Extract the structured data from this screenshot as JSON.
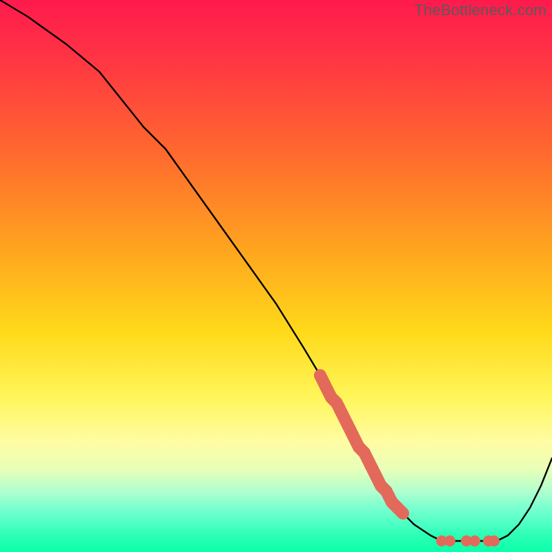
{
  "chart_data": {
    "type": "line",
    "title": "",
    "xlabel": "",
    "ylabel": "",
    "xlim": [
      0,
      100
    ],
    "ylim": [
      0,
      100
    ],
    "series": [
      {
        "name": "bottleneck-curve",
        "x": [
          0,
          5,
          12,
          18,
          22,
          26,
          30,
          35,
          40,
          45,
          50,
          55,
          58,
          61,
          63,
          64,
          67,
          70,
          72,
          73,
          75,
          78,
          80,
          82,
          83,
          85,
          88,
          90,
          92,
          94,
          96,
          98,
          100
        ],
        "values": [
          100,
          97,
          92,
          87,
          82,
          77,
          73,
          66,
          59,
          52,
          45,
          37,
          32,
          27,
          23,
          21,
          16,
          11,
          8,
          7,
          5,
          3,
          2,
          2,
          2,
          2,
          2,
          2,
          3,
          5,
          8,
          12,
          17
        ]
      }
    ],
    "highlight_segment": {
      "name": "highlight-thick-segment",
      "x": [
        58,
        59,
        60,
        61,
        62,
        63,
        64,
        65,
        66,
        67,
        68,
        69,
        70,
        71,
        72,
        73
      ],
      "values": [
        32,
        30,
        28,
        27,
        25,
        23,
        21,
        19,
        18,
        16,
        14,
        12,
        11,
        9,
        8,
        7
      ]
    },
    "dots": {
      "name": "marker-dots",
      "x": [
        80,
        81.5,
        84.5,
        86,
        88.5,
        89.5
      ],
      "values": [
        2,
        2,
        2,
        2,
        2,
        2
      ]
    },
    "watermark": "TheBottleneck.com"
  }
}
